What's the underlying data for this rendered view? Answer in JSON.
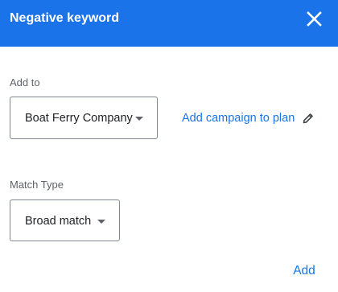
{
  "dialog": {
    "title": "Negative keyword",
    "close_icon": "close-icon"
  },
  "add_to": {
    "label": "Add to",
    "selected": "Boat Ferry Company",
    "link_label": "Add campaign to plan",
    "link_icon": "pencil-icon"
  },
  "match_type": {
    "label": "Match Type",
    "selected": "Broad match"
  },
  "actions": {
    "add_label": "Add"
  },
  "colors": {
    "header": "#1a73e8",
    "link": "#1a73e8",
    "label": "#5f6368",
    "text": "#202124"
  }
}
